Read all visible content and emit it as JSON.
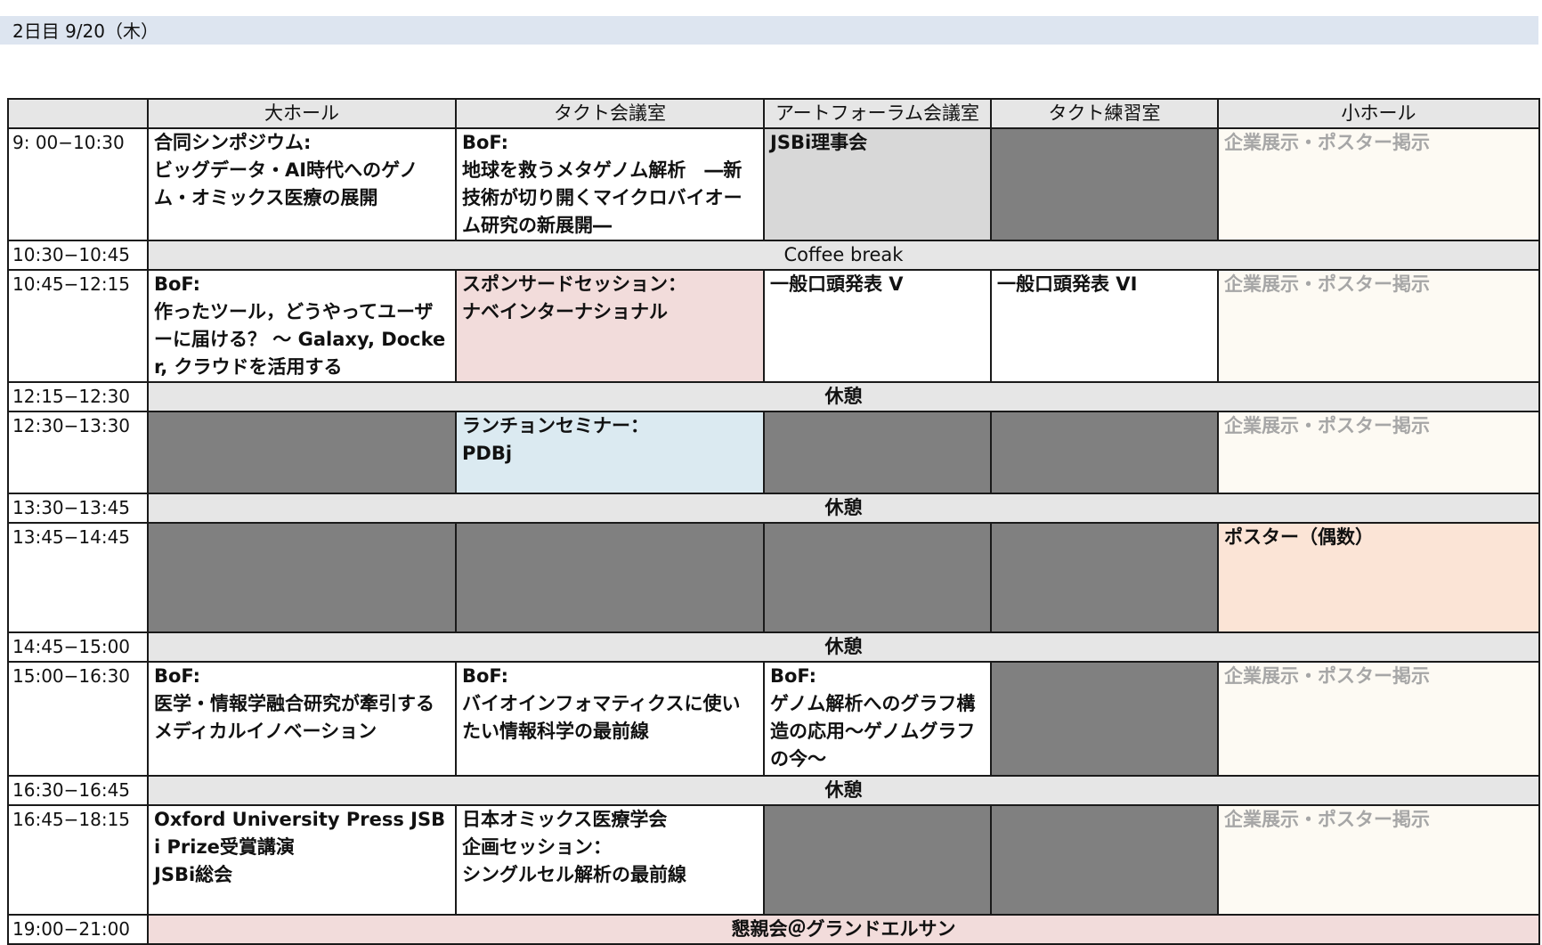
{
  "day_title": "2日目 9/20（木）",
  "rooms": [
    "",
    "大ホール",
    "タクト会議室",
    "アートフォーラム会議室",
    "タクト練習室",
    "小ホール"
  ],
  "slots": [
    {
      "time": "9: 00−10:30",
      "cells": [
        {
          "text": "合同シンポジウム:\nビッグデータ・AI時代へのゲノム・オミックス医療の展開"
        },
        {
          "text": "BoF:\n地球を救うメタゲノム解析　―新技術が切り開くマイクロバイオーム研究の新展開―"
        },
        {
          "text": "JSBi理事会"
        },
        {
          "text": ""
        },
        {
          "text": "企業展示・ポスター掲示"
        }
      ]
    },
    {
      "time": "10:30−10:45",
      "break": "Coffee break"
    },
    {
      "time": "10:45−12:15",
      "cells": [
        {
          "text": "BoF:\n作ったツール，どうやってユーザーに届ける？ ～ Galaxy, Docker, クラウドを活用する"
        },
        {
          "text": "スポンサードセッション：\nナベインターナショナル"
        },
        {
          "text": "一般口頭発表 V"
        },
        {
          "text": "一般口頭発表 VI"
        },
        {
          "text": "企業展示・ポスター掲示"
        }
      ]
    },
    {
      "time": "12:15−12:30",
      "break": "休憩"
    },
    {
      "time": "12:30−13:30",
      "cells": [
        {
          "text": ""
        },
        {
          "text": "ランチョンセミナー：\nPDBj"
        },
        {
          "text": ""
        },
        {
          "text": ""
        },
        {
          "text": "企業展示・ポスター掲示"
        }
      ]
    },
    {
      "time": "13:30−13:45",
      "break": "休憩"
    },
    {
      "time": "13:45−14:45",
      "cells": [
        {
          "text": ""
        },
        {
          "text": ""
        },
        {
          "text": ""
        },
        {
          "text": ""
        },
        {
          "text": "ポスター（偶数）"
        }
      ]
    },
    {
      "time": "14:45−15:00",
      "break": "休憩"
    },
    {
      "time": "15:00−16:30",
      "cells": [
        {
          "text": "BoF:\n医学・情報学融合研究が牽引するメディカルイノベーション"
        },
        {
          "text": "BoF:\nバイオインフォマティクスに使いたい情報科学の最前線"
        },
        {
          "text": "BoF:\nゲノム解析へのグラフ構造の応用～ゲノムグラフの今～"
        },
        {
          "text": ""
        },
        {
          "text": "企業展示・ポスター掲示"
        }
      ]
    },
    {
      "time": "16:30−16:45",
      "break": "休憩"
    },
    {
      "time": "16:45−18:15",
      "cells": [
        {
          "text": "Oxford University Press JSBi Prize受賞講演\nJSBi総会"
        },
        {
          "text": "日本オミックス医療学会\n企画セッション：\nシングルセル解析の最前線"
        },
        {
          "text": ""
        },
        {
          "text": ""
        },
        {
          "text": "企業展示・ポスター掲示"
        }
      ]
    },
    {
      "time": "19:00−21:00",
      "span_event": "懇親会＠グランドエルサン"
    }
  ],
  "colors": {
    "header": "#e6e6e6",
    "unused": "#808080",
    "board": "#d8d8d8",
    "sponsored": "#f2dcdb",
    "luncheon": "#dbeaf1",
    "poster": "#fbe4d6",
    "exhibit": "#fdfaf3"
  }
}
